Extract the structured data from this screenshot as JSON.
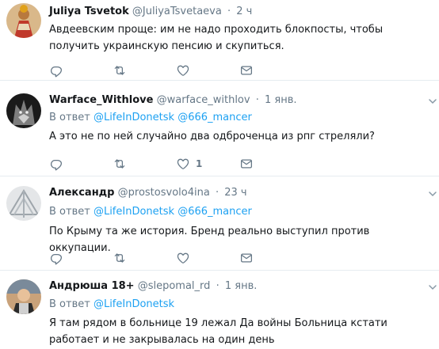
{
  "colors": {
    "link": "#1da1f2",
    "secondary_text": "#657786",
    "primary_text": "#14171a",
    "separator": "#e6ecf0"
  },
  "reply_prefix": "В ответ",
  "tweets": [
    {
      "name": "Juliya Tsvetok",
      "handle": "@JuliyaTsvetaeva",
      "time": "2 ч",
      "reply_to": [],
      "text": "Авдеевским проще: им не надо проходить блокпосты, чтобы получить украинскую пенсию и скупиться.",
      "like_count": ""
    },
    {
      "name": "Warface_Withlove",
      "handle": "@warface_withlov",
      "time": "1 янв.",
      "reply_to": [
        "@LifeInDonetsk",
        "@666_mancer"
      ],
      "text": "А это не по ней случайно два одброченца из рпг стреляли?",
      "like_count": "1"
    },
    {
      "name": "Александр",
      "handle": "@prostosvolo4ina",
      "time": "23 ч",
      "reply_to": [
        "@LifeInDonetsk",
        "@666_mancer"
      ],
      "text": "По Крыму та же история. Бренд реально выступил против оккупации.",
      "like_count": ""
    },
    {
      "name": "Андрюша 18+",
      "handle": "@slepomal_rd",
      "time": "1 янв.",
      "reply_to": [
        "@LifeInDonetsk"
      ],
      "text": "Я там рядом в больнице 19 лежал Да войны Больница кстати работает и не закрывалась на один день",
      "like_count": ""
    }
  ]
}
